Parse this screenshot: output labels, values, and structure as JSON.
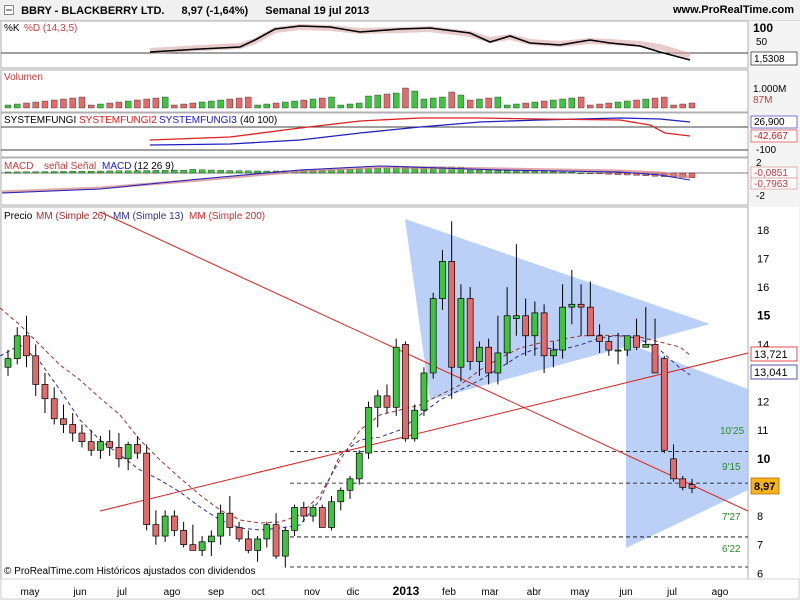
{
  "header": {
    "symbol": "BBRY - BLACKBERRY LTD.",
    "quote": "8,97 (-1,64%)",
    "period": "Semanal  19 jul 2013",
    "site": "www.ProRealTime.com"
  },
  "panels": {
    "stoch": {
      "label_k": "%K",
      "label_d": "%D (14,3,5)",
      "ticks": [
        "100",
        "50"
      ],
      "last": "1,5308"
    },
    "volume": {
      "label": "Volumen",
      "ticks": [
        "1.000M"
      ],
      "last": "87M"
    },
    "sysfungi": {
      "label1": "SYSTEMFUNGI",
      "label2": "SYSTEMFUNGI2",
      "label3": "SYSTEMFUNGI3",
      "params": "(40 100)",
      "ticks": [
        "100",
        "-100"
      ],
      "last1": "26,900",
      "last2": "-42,667"
    },
    "macd": {
      "label1": "MACD",
      "label2": "señal Señal",
      "label3": "MACD",
      "params": "(12 26 9)",
      "ticks": [
        "2",
        "-2"
      ],
      "last1": "-0,0851",
      "last2": "-0,7963"
    },
    "price": {
      "label": "Precio",
      "ma26": "MM (Simple 26)",
      "ma13": "MM (Simple 13)",
      "ma200": "MM (Simple 200)",
      "last_price": "8,97",
      "ma_values": [
        "13,721",
        "13,041"
      ],
      "levels": [
        "10'25",
        "9'15",
        "7'27",
        "6'22"
      ]
    }
  },
  "chart_data": {
    "type": "candlestick",
    "title": "BBRY - BLACKBERRY LTD.",
    "ylim": [
      5.8,
      18.8
    ],
    "y_ticks": [
      6,
      7,
      8,
      9,
      10,
      11,
      12,
      13,
      14,
      15,
      16,
      17,
      18
    ],
    "x_ticks": [
      "may",
      "jun",
      "jul",
      "ago",
      "sep",
      "oct",
      "nov",
      "dic",
      "2013",
      "feb",
      "mar",
      "abr",
      "may",
      "jun",
      "jul",
      "ago"
    ],
    "candles": [
      [
        13.2,
        13.8,
        12.9,
        13.5
      ],
      [
        13.5,
        14.6,
        13.3,
        14.3
      ],
      [
        14.3,
        15.0,
        13.2,
        13.6
      ],
      [
        13.6,
        14.0,
        12.2,
        12.6
      ],
      [
        12.6,
        13.0,
        11.6,
        12.1
      ],
      [
        12.1,
        12.5,
        11.2,
        11.4
      ],
      [
        11.4,
        11.9,
        10.9,
        11.2
      ],
      [
        11.2,
        11.6,
        10.6,
        10.9
      ],
      [
        10.9,
        11.2,
        10.4,
        10.6
      ],
      [
        10.6,
        11.0,
        10.1,
        10.3
      ],
      [
        10.3,
        10.8,
        10.0,
        10.6
      ],
      [
        10.6,
        11.0,
        10.1,
        10.4
      ],
      [
        10.4,
        10.9,
        9.7,
        10.0
      ],
      [
        10.0,
        10.6,
        9.6,
        10.5
      ],
      [
        10.5,
        10.8,
        10.0,
        10.2
      ],
      [
        10.2,
        10.5,
        7.5,
        7.7
      ],
      [
        7.7,
        8.2,
        7.0,
        7.3
      ],
      [
        7.3,
        8.2,
        7.1,
        8.0
      ],
      [
        8.0,
        8.2,
        7.3,
        7.5
      ],
      [
        7.5,
        7.8,
        6.9,
        7.0
      ],
      [
        7.0,
        7.7,
        6.8,
        6.8
      ],
      [
        6.8,
        7.3,
        6.6,
        7.1
      ],
      [
        7.1,
        7.5,
        6.6,
        7.3
      ],
      [
        7.3,
        8.4,
        7.0,
        8.1
      ],
      [
        8.1,
        8.7,
        7.3,
        7.6
      ],
      [
        7.6,
        7.8,
        7.1,
        7.2
      ],
      [
        7.2,
        7.5,
        6.7,
        6.8
      ],
      [
        6.8,
        7.3,
        6.4,
        7.2
      ],
      [
        7.2,
        7.8,
        6.9,
        7.7
      ],
      [
        7.7,
        8.1,
        6.5,
        6.6
      ],
      [
        6.6,
        7.6,
        6.2,
        7.5
      ],
      [
        7.5,
        8.4,
        7.3,
        8.3
      ],
      [
        8.3,
        8.5,
        7.8,
        8.0
      ],
      [
        8.0,
        8.4,
        7.8,
        8.3
      ],
      [
        8.3,
        8.4,
        7.8,
        7.6
      ],
      [
        7.6,
        8.7,
        7.5,
        8.5
      ],
      [
        8.5,
        9.0,
        8.2,
        8.9
      ],
      [
        8.9,
        9.4,
        8.6,
        9.3
      ],
      [
        9.3,
        10.3,
        9.1,
        10.2
      ],
      [
        10.2,
        12.0,
        10.0,
        11.8
      ],
      [
        11.8,
        12.4,
        11.1,
        12.2
      ],
      [
        12.2,
        12.6,
        11.6,
        11.8
      ],
      [
        11.8,
        14.2,
        11.5,
        13.9
      ],
      [
        14.0,
        14.1,
        10.6,
        10.7
      ],
      [
        10.7,
        11.9,
        10.6,
        11.7
      ],
      [
        11.7,
        13.2,
        11.5,
        13.0
      ],
      [
        13.0,
        15.8,
        12.8,
        15.6
      ],
      [
        15.6,
        17.3,
        15.2,
        16.9
      ],
      [
        16.9,
        18.3,
        12.1,
        13.2
      ],
      [
        13.2,
        16.1,
        12.7,
        15.6
      ],
      [
        15.6,
        16.0,
        13.1,
        13.4
      ],
      [
        13.4,
        14.1,
        12.9,
        13.9
      ],
      [
        13.9,
        14.2,
        12.6,
        13.0
      ],
      [
        13.0,
        15.0,
        12.6,
        13.7
      ],
      [
        13.7,
        16.0,
        13.3,
        15.0
      ],
      [
        14.9,
        17.5,
        14.3,
        15.0
      ],
      [
        15.0,
        15.6,
        13.6,
        14.3
      ],
      [
        14.3,
        15.5,
        13.6,
        15.1
      ],
      [
        15.1,
        15.4,
        13.0,
        13.6
      ],
      [
        13.6,
        14.1,
        13.2,
        13.8
      ],
      [
        13.8,
        16.1,
        13.5,
        15.3
      ],
      [
        15.3,
        16.6,
        14.7,
        15.4
      ],
      [
        15.4,
        16.1,
        14.3,
        15.3
      ],
      [
        15.3,
        16.2,
        14.3,
        14.3
      ],
      [
        14.3,
        14.7,
        13.7,
        14.1
      ],
      [
        14.1,
        14.3,
        13.6,
        13.8
      ],
      [
        13.8,
        14.4,
        13.3,
        13.8
      ],
      [
        13.8,
        14.3,
        13.6,
        14.3
      ],
      [
        14.3,
        14.9,
        13.8,
        13.9
      ],
      [
        13.9,
        15.3,
        13.9,
        14.0
      ],
      [
        14.0,
        14.9,
        13.0,
        13.0
      ],
      [
        13.5,
        13.6,
        10.2,
        10.3
      ],
      [
        10.0,
        10.5,
        9.2,
        9.3
      ],
      [
        9.3,
        9.4,
        8.9,
        9.0
      ],
      [
        9.1,
        9.3,
        8.8,
        8.97
      ]
    ],
    "moving_averages": [
      {
        "name": "MM (Simple 26)",
        "color": "#b04040"
      },
      {
        "name": "MM (Simple 13)",
        "color": "#303090"
      },
      {
        "name": "MM (Simple 200)",
        "color": "#c83030"
      }
    ],
    "support_levels": [
      10.25,
      9.15,
      7.27,
      6.22
    ]
  },
  "footer": {
    "text": "© ProRealTime.com Históricos ajustados con dividendos"
  }
}
